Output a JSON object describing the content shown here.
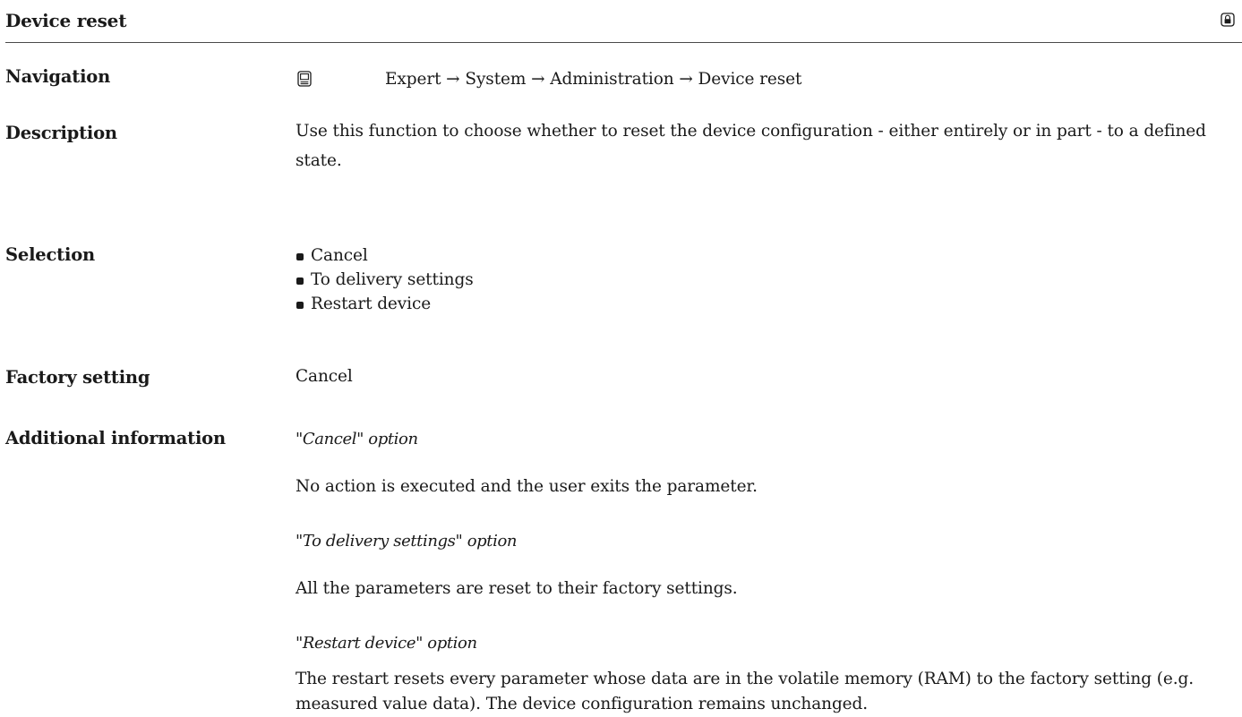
{
  "header": {
    "title": "Device reset",
    "icon": "lock-icon"
  },
  "navigation": {
    "label": "Navigation",
    "icon": "display-icon",
    "path": "Expert → System → Administration → Device reset"
  },
  "description": {
    "label": "Description",
    "text": "Use this function to choose whether to reset the device configuration - either entirely or in part - to a defined state."
  },
  "selection": {
    "label": "Selection",
    "options": [
      "Cancel",
      "To delivery settings",
      "Restart device"
    ]
  },
  "factory_setting": {
    "label": "Factory setting",
    "value": "Cancel"
  },
  "additional_information": {
    "label": "Additional information",
    "items": [
      {
        "heading": "\"Cancel\" option",
        "text": "No action is executed and the user exits the parameter."
      },
      {
        "heading": "\"To delivery settings\" option",
        "text": "All the parameters are reset to their factory settings."
      },
      {
        "heading": "\"Restart device\" option",
        "text": "The restart resets every parameter whose data are in the volatile memory (RAM) to the factory setting (e.g. measured value data). The device configuration remains unchanged."
      }
    ]
  }
}
